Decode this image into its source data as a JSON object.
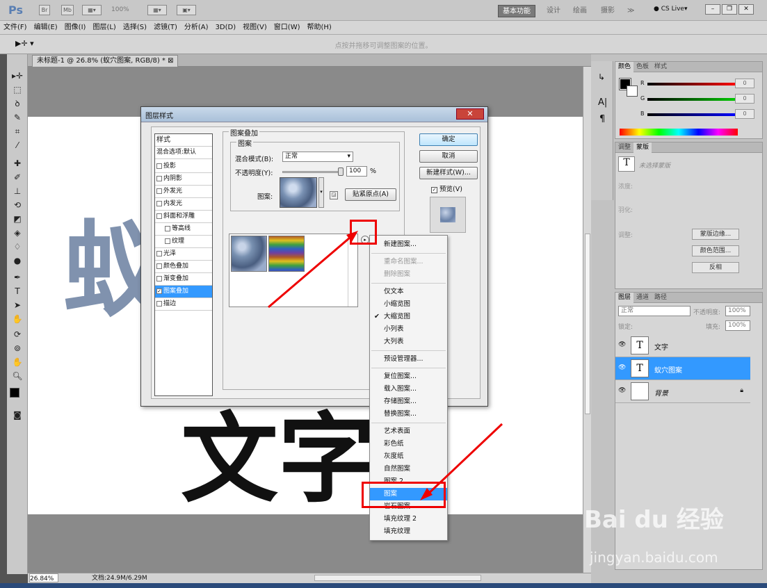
{
  "app": {
    "logo": "Ps",
    "zoom": "100%",
    "workspaces": [
      "基本功能",
      "设计",
      "绘画",
      "摄影",
      "≫"
    ],
    "cslive": "CS Live▾"
  },
  "menus": [
    "文件(F)",
    "编辑(E)",
    "图像(I)",
    "图层(L)",
    "选择(S)",
    "滤镜(T)",
    "分析(A)",
    "3D(D)",
    "视图(V)",
    "窗口(W)",
    "帮助(H)"
  ],
  "options_hint": "点按并拖移可调整图案的位置。",
  "document": {
    "tab_title": "未标题-1 @ 26.8% (蚁穴图案, RGB/8) *",
    "canvas_text_top": "蚁穴图案",
    "canvas_text_bottom": "文字"
  },
  "status": {
    "zoom": "26.84%",
    "doc": "文档:24.9M/6.29M"
  },
  "color_panel": {
    "tabs": [
      "颜色",
      "色板",
      "样式"
    ],
    "channels": [
      {
        "name": "R",
        "value": "0"
      },
      {
        "name": "G",
        "value": "0"
      },
      {
        "name": "B",
        "value": "0"
      }
    ]
  },
  "mask_panel": {
    "tabs": [
      "调整",
      "蒙版"
    ],
    "hint": "未选择蒙版",
    "density": "浓度:",
    "feather": "羽化:",
    "adjust": "调整:",
    "buttons": [
      "蒙版边缘...",
      "颜色范围...",
      "反相"
    ]
  },
  "layers_panel": {
    "tabs": [
      "图层",
      "通道",
      "路径"
    ],
    "blend": "正常",
    "opacity_label": "不透明度:",
    "opacity": "100%",
    "lock_label": "锁定:",
    "fill_label": "填充:",
    "fill": "100%",
    "layers": [
      {
        "name": "文字",
        "thumb": "T",
        "selected": false
      },
      {
        "name": "蚁穴图案",
        "thumb": "T",
        "selected": true
      },
      {
        "name": "背景",
        "thumb": "",
        "selected": false
      }
    ]
  },
  "dialog": {
    "title": "图层样式",
    "styles_header": "样式",
    "blend_default": "混合选项:默认",
    "items": [
      {
        "label": "投影",
        "checked": false,
        "sub": false
      },
      {
        "label": "内阴影",
        "checked": false,
        "sub": false
      },
      {
        "label": "外发光",
        "checked": false,
        "sub": false
      },
      {
        "label": "内发光",
        "checked": false,
        "sub": false
      },
      {
        "label": "斜面和浮雕",
        "checked": false,
        "sub": false
      },
      {
        "label": "等高线",
        "checked": false,
        "sub": true
      },
      {
        "label": "纹理",
        "checked": false,
        "sub": true
      },
      {
        "label": "光泽",
        "checked": false,
        "sub": false
      },
      {
        "label": "颜色叠加",
        "checked": false,
        "sub": false
      },
      {
        "label": "渐变叠加",
        "checked": false,
        "sub": false
      },
      {
        "label": "图案叠加",
        "checked": true,
        "sub": false,
        "selected": true
      },
      {
        "label": "描边",
        "checked": false,
        "sub": false
      }
    ],
    "group_title": "图案叠加",
    "subgroup_title": "图案",
    "blend_mode_label": "混合模式(B):",
    "blend_mode_value": "正常",
    "opacity_label": "不透明度(Y):",
    "opacity_value": "100",
    "opacity_unit": "%",
    "pattern_label": "图案:",
    "snap_button": "贴紧原点(A)",
    "ok": "确定",
    "cancel": "取消",
    "new_style": "新建样式(W)...",
    "preview": "预览(V)"
  },
  "context_menu": {
    "items": [
      {
        "label": "新建图案...",
        "state": "normal"
      },
      {
        "sep": true
      },
      {
        "label": "重命名图案...",
        "state": "disabled"
      },
      {
        "label": "删除图案",
        "state": "disabled"
      },
      {
        "sep": true
      },
      {
        "label": "仅文本",
        "state": "normal"
      },
      {
        "label": "小缩览图",
        "state": "normal"
      },
      {
        "label": "大缩览图",
        "state": "checked"
      },
      {
        "label": "小列表",
        "state": "normal"
      },
      {
        "label": "大列表",
        "state": "normal"
      },
      {
        "sep": true
      },
      {
        "label": "预设管理器...",
        "state": "normal"
      },
      {
        "sep": true
      },
      {
        "label": "复位图案...",
        "state": "normal"
      },
      {
        "label": "载入图案...",
        "state": "normal"
      },
      {
        "label": "存储图案...",
        "state": "normal"
      },
      {
        "label": "替换图案...",
        "state": "normal"
      },
      {
        "sep": true
      },
      {
        "label": "艺术表面",
        "state": "normal"
      },
      {
        "label": "彩色纸",
        "state": "normal"
      },
      {
        "label": "灰度纸",
        "state": "normal"
      },
      {
        "label": "自然图案",
        "state": "normal"
      },
      {
        "label": "图案 2",
        "state": "normal"
      },
      {
        "label": "图案",
        "state": "highlighted"
      },
      {
        "label": "岩石图案",
        "state": "normal"
      },
      {
        "label": "填充纹理 2",
        "state": "normal"
      },
      {
        "label": "填充纹理",
        "state": "normal"
      }
    ]
  },
  "watermark": {
    "brand": "Bai du 经验",
    "url": "jingyan.baidu.com"
  },
  "colors": {
    "accent": "#3399ff",
    "annotation": "#e00000"
  }
}
